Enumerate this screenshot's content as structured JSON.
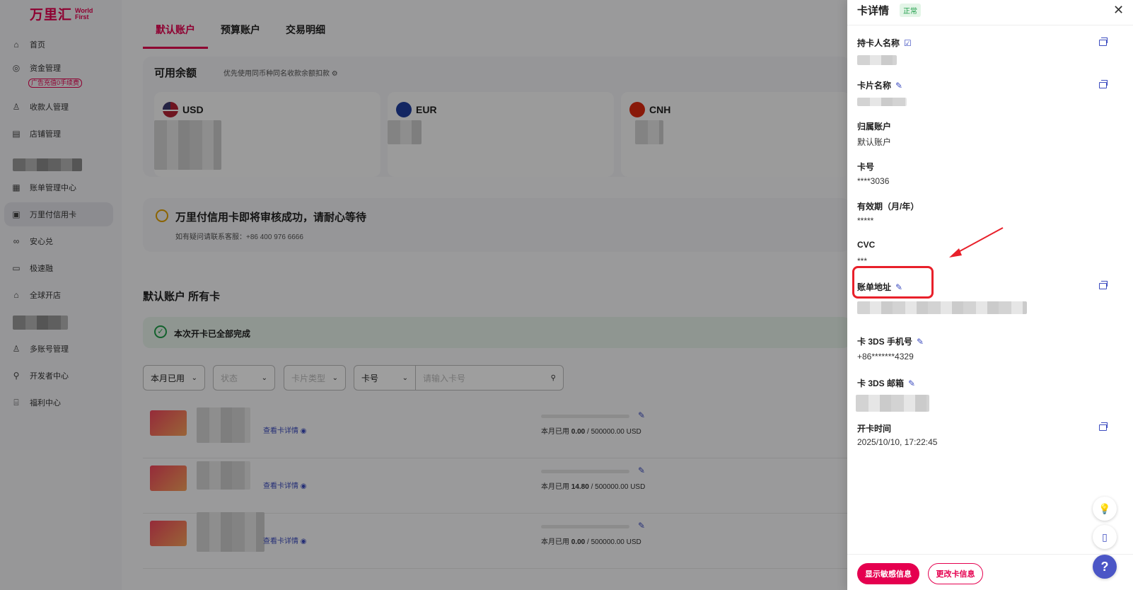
{
  "brand": {
    "name_cn": "万里汇",
    "name_en": "World First"
  },
  "sidebar": {
    "items": [
      {
        "label": "首页",
        "icon": "home-icon"
      },
      {
        "label": "资金管理",
        "icon": "funds-icon",
        "badge": "广告充值0手续费"
      },
      {
        "label": "收款人管理",
        "icon": "user-icon"
      },
      {
        "label": "店铺管理",
        "icon": "store-icon"
      },
      {
        "label": "账单管理中心",
        "icon": "bill-icon"
      },
      {
        "label": "万里付信用卡",
        "icon": "card-icon"
      },
      {
        "label": "安心兑",
        "icon": "exchange-icon"
      },
      {
        "label": "极速融",
        "icon": "finance-icon"
      },
      {
        "label": "全球开店",
        "icon": "shop-icon"
      },
      {
        "label": "多账号管理",
        "icon": "accounts-icon"
      },
      {
        "label": "开发者中心",
        "icon": "developer-icon"
      },
      {
        "label": "福利中心",
        "icon": "gift-icon"
      }
    ]
  },
  "main": {
    "tabs": [
      "默认账户",
      "预算账户",
      "交易明细"
    ],
    "balance": {
      "title": "可用余额",
      "hint": "优先使用同币种同名收款余额扣款",
      "currencies": [
        "USD",
        "EUR",
        "CNH"
      ]
    },
    "notice": {
      "title": "万里付信用卡即将审核成功，请耐心等待",
      "subtitle": "如有疑问请联系客服：+86 400 976 6666"
    },
    "account_title": "默认账户  所有卡",
    "done_text": "本次开卡已全部完成",
    "filters": {
      "month": "本月已用",
      "status_ph": "状态",
      "type_ph": "卡片类型",
      "field": "卡号",
      "search_ph": "请输入卡号"
    },
    "cards": [
      {
        "link": "查看卡详情",
        "used_label": "本月已用",
        "used": "0.00",
        "limit": "/ 500000.00 USD"
      },
      {
        "link": "查看卡详情",
        "used_label": "本月已用",
        "used": "14.80",
        "limit": "/ 500000.00 USD"
      },
      {
        "link": "查看卡详情",
        "used_label": "本月已用",
        "used": "0.00",
        "limit": "/ 500000.00 USD"
      }
    ]
  },
  "drawer": {
    "title": "卡详情",
    "status": "正常",
    "fields": {
      "holder_label": "持卡人名称",
      "card_name_label": "卡片名称",
      "account_label": "归属账户",
      "account_value": "默认账户",
      "number_label": "卡号",
      "number_value": "****3036",
      "expiry_label": "有效期（月/年）",
      "expiry_value": "*****",
      "cvc_label": "CVC",
      "cvc_value": "***",
      "billing_label": "账单地址",
      "phone_label": "卡 3DS 手机号",
      "phone_value": "+86*******4329",
      "email_label": "卡 3DS 邮箱",
      "opened_label": "开卡时间",
      "opened_value": "2025/10/10, 17:22:45"
    },
    "buttons": {
      "show_sensitive": "显示敏感信息",
      "edit_card": "更改卡信息"
    }
  },
  "colors": {
    "brand": "#e5004f",
    "link": "#3b4bbf",
    "highlight": "#e8202a",
    "success": "#1f9e4a"
  }
}
